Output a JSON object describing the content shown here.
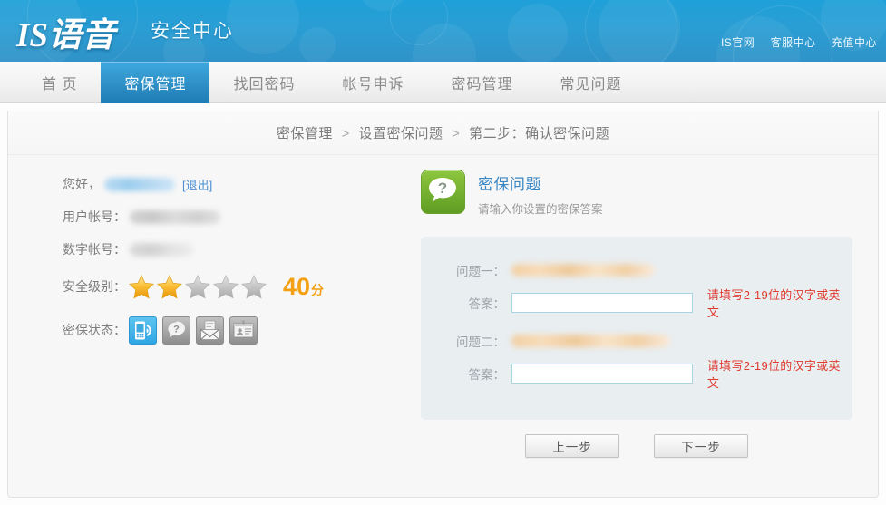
{
  "header": {
    "logo": "IS语音",
    "logo_sub": "安全中心",
    "top_links": [
      {
        "label": "IS官网"
      },
      {
        "label": "客服中心"
      },
      {
        "label": "充值中心"
      }
    ]
  },
  "nav": {
    "items": [
      {
        "label": "首 页",
        "active": false
      },
      {
        "label": "密保管理",
        "active": true
      },
      {
        "label": "找回密码",
        "active": false
      },
      {
        "label": "帐号申诉",
        "active": false
      },
      {
        "label": "密码管理",
        "active": false
      },
      {
        "label": "常见问题",
        "active": false
      }
    ]
  },
  "breadcrumb": {
    "item1": "密保管理",
    "sep1": ">",
    "item2": "设置密保问题",
    "sep2": ">",
    "item3": "第二步：确认密保问题"
  },
  "account": {
    "greeting_label": "您好，",
    "username_masked": "",
    "logout_label": "[退出]",
    "user_account_label": "用户帐号：",
    "user_account_masked": "",
    "number_account_label": "数字帐号：",
    "number_account_masked": "",
    "level_label": "安全级别：",
    "stars_filled": 2,
    "stars_total": 5,
    "score": "40",
    "score_unit": "分",
    "status_label": "密保状态：",
    "status_badges": [
      {
        "icon": "mobile-phone-icon",
        "active": true
      },
      {
        "icon": "question-mark-icon",
        "active": false
      },
      {
        "icon": "envelope-icon",
        "active": false
      },
      {
        "icon": "id-card-icon",
        "active": false
      }
    ]
  },
  "question_panel": {
    "icon": "question-bubble-icon",
    "icon_color": "#78b32e",
    "title": "密保问题",
    "title_color": "#3a87c4",
    "subtitle": "请输入你设置的密保答案",
    "rows": [
      {
        "question_label": "问题一：",
        "question_value_masked": "",
        "answer_label": "答案：",
        "answer_value": "",
        "hint": "请填写2-19位的汉字或英文",
        "hint_color": "#e03a2f"
      },
      {
        "question_label": "问题二：",
        "question_value_masked": "",
        "answer_label": "答案：",
        "answer_value": "",
        "hint": "请填写2-19位的汉字或英文",
        "hint_color": "#e03a2f"
      }
    ]
  },
  "buttons": {
    "prev": "上一步",
    "next": "下一步"
  }
}
